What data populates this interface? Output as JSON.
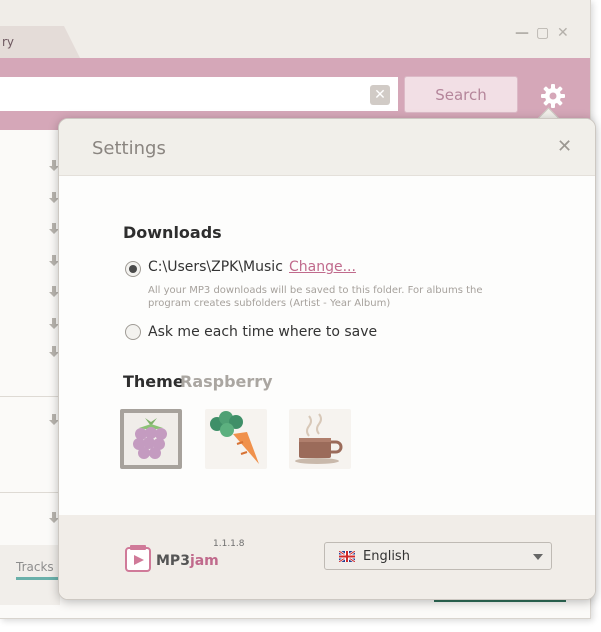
{
  "window": {
    "tab_label": "ry",
    "minimize_glyph": "—",
    "maximize_glyph": "▢",
    "close_glyph": "✕"
  },
  "toolbar": {
    "search_value": "",
    "clear_glyph": "✕",
    "search_label": "Search",
    "settings_icon": "gear-icon"
  },
  "footer": {
    "tracks_label": "Tracks"
  },
  "settings": {
    "title": "Settings",
    "close_glyph": "✕",
    "downloads": {
      "heading": "Downloads",
      "path": "C:\\Users\\ZPK\\Music",
      "change_link": "Change...",
      "hint": "All your MP3 downloads will be saved to this folder. For albums the program creates subfolders (Artist - Year Album)",
      "ask_option": "Ask me each time where to save",
      "selected_option": "folder"
    },
    "theme": {
      "heading": "Theme",
      "current": "Raspberry",
      "options": [
        {
          "icon": "raspberry-icon",
          "selected": true
        },
        {
          "icon": "carrot-icon",
          "selected": false
        },
        {
          "icon": "coffee-icon",
          "selected": false
        }
      ]
    },
    "app": {
      "logo_text_mp3": "MP3",
      "logo_text_jam": "jam",
      "version": "1.1.1.8"
    },
    "language": {
      "selected": "English",
      "flag_icon": "uk-flag-icon"
    }
  },
  "colors": {
    "accent": "#d5a7b8",
    "link": "#c06a8c",
    "search_button": "#f2dfe5"
  }
}
